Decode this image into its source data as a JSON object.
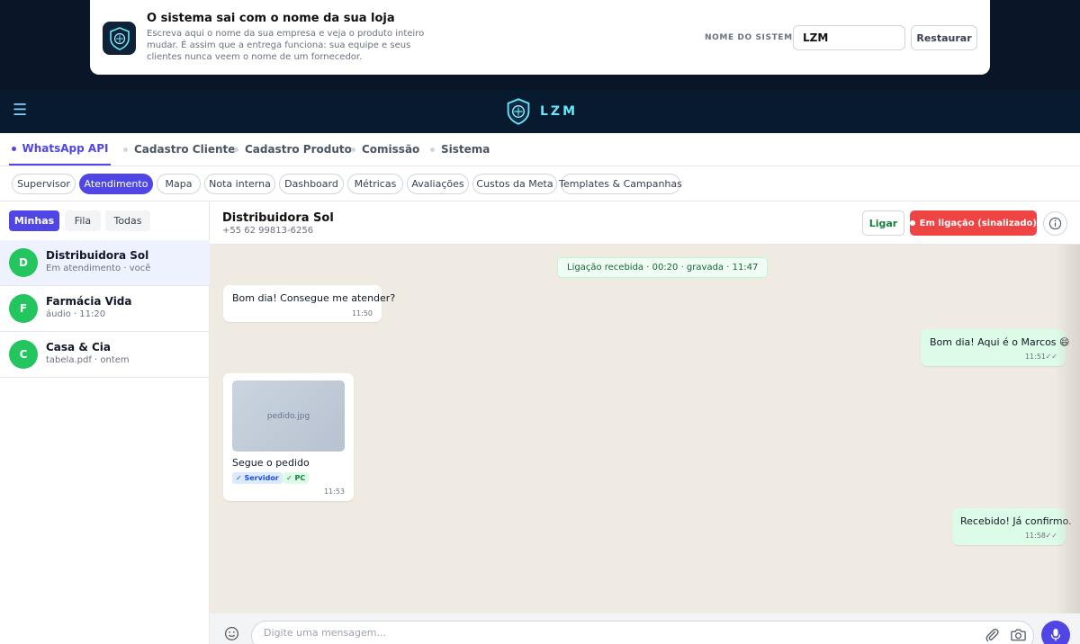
{
  "banner": {
    "title": "O sistema sai com o nome da sua loja",
    "description": "Escreva aqui o nome da sua empresa e veja o produto inteiro mudar. É assim que a entrega funciona: sua equipe e seus clientes nunca veem o nome de um fornecedor.",
    "system_name_label": "NOME DO SISTEMA",
    "system_name_value": "LZM",
    "restore_label": "Restaurar",
    "logo_icon": "shield-logo-icon"
  },
  "header": {
    "menu_icon": "hamburger-icon",
    "logo_text": "LZM",
    "accent_color": "#67e8f9"
  },
  "nav": {
    "tabs": [
      {
        "label": "WhatsApp API",
        "active": true
      },
      {
        "label": "Cadastro Cliente",
        "active": false
      },
      {
        "label": "Cadastro Produto",
        "active": false
      },
      {
        "label": "Comissão",
        "active": false
      },
      {
        "label": "Sistema",
        "active": false
      }
    ]
  },
  "subnav": {
    "pills": [
      {
        "label": "Supervisor",
        "active": false
      },
      {
        "label": "Atendimento",
        "active": true
      },
      {
        "label": "Mapa",
        "active": false
      },
      {
        "label": "Nota interna",
        "active": false
      },
      {
        "label": "Dashboard",
        "active": false
      },
      {
        "label": "Métricas",
        "active": false
      },
      {
        "label": "Avaliações",
        "active": false
      },
      {
        "label": "Custos da Meta",
        "active": false
      },
      {
        "label": "Templates & Campanhas",
        "active": false
      }
    ]
  },
  "sidebar": {
    "filters": [
      {
        "label": "Minhas",
        "active": true
      },
      {
        "label": "Fila",
        "active": false
      },
      {
        "label": "Todas",
        "active": false
      }
    ],
    "conversations": [
      {
        "initial": "D",
        "name": "Distribuidora Sol",
        "subtitle": "Em atendimento · você",
        "active": true
      },
      {
        "initial": "F",
        "name": "Farmácia Vida",
        "subtitle": "áudio · 11:20",
        "active": false
      },
      {
        "initial": "C",
        "name": "Casa & Cia",
        "subtitle": "tabela.pdf · ontem",
        "active": false
      }
    ]
  },
  "chat": {
    "contact_name": "Distribuidora Sol",
    "contact_phone": "+55 62 99813-6256",
    "call_label": "Ligar",
    "in_call_label": "Em ligação (sinalizado)",
    "info_icon": "info-icon",
    "system_message": "Ligação recebida · 00:20 · gravada · 11:47",
    "messages": [
      {
        "direction": "in",
        "text": "Bom dia! Consegue me atender?",
        "time": "11:50"
      },
      {
        "direction": "out",
        "text": "Bom dia! Aqui é o Marcos 😄",
        "time": "11:51",
        "ticks": "✓✓"
      },
      {
        "direction": "in",
        "image_name": "pedido.jpg",
        "text": "Segue o pedido",
        "tags": [
          "✓ Servidor",
          "✓ PC"
        ],
        "time": "11:53"
      },
      {
        "direction": "out",
        "text": "Recebido! Já confirmo.",
        "time": "11:58",
        "ticks": "✓✓"
      }
    ]
  },
  "composer": {
    "placeholder": "Digite uma mensagem...",
    "emoji_icon": "emoji-icon",
    "attach_icon": "paperclip-icon",
    "camera_icon": "camera-icon",
    "mic_icon": "microphone-icon",
    "accent_color": "#4f46e5"
  }
}
